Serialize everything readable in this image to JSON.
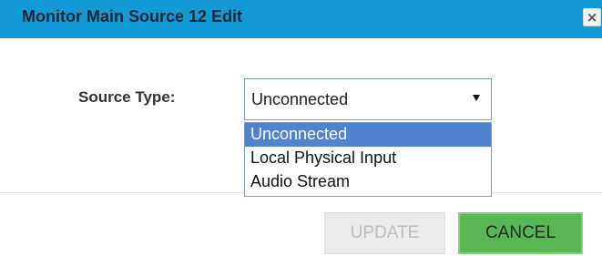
{
  "dialog": {
    "title": "Monitor Main Source 12 Edit",
    "close_icon": "close-icon",
    "close_glyph": "×",
    "header_color": "#129ad6"
  },
  "form": {
    "source_type_label": "Source Type:",
    "source_type_value": "Unconnected",
    "options": [
      "Unconnected",
      "Local Physical Input",
      "Audio Stream"
    ],
    "highlighted_option": "Unconnected"
  },
  "buttons": {
    "update_label": "UPDATE",
    "update_enabled": false,
    "cancel_label": "CANCEL",
    "cancel_color": "#59b655"
  }
}
